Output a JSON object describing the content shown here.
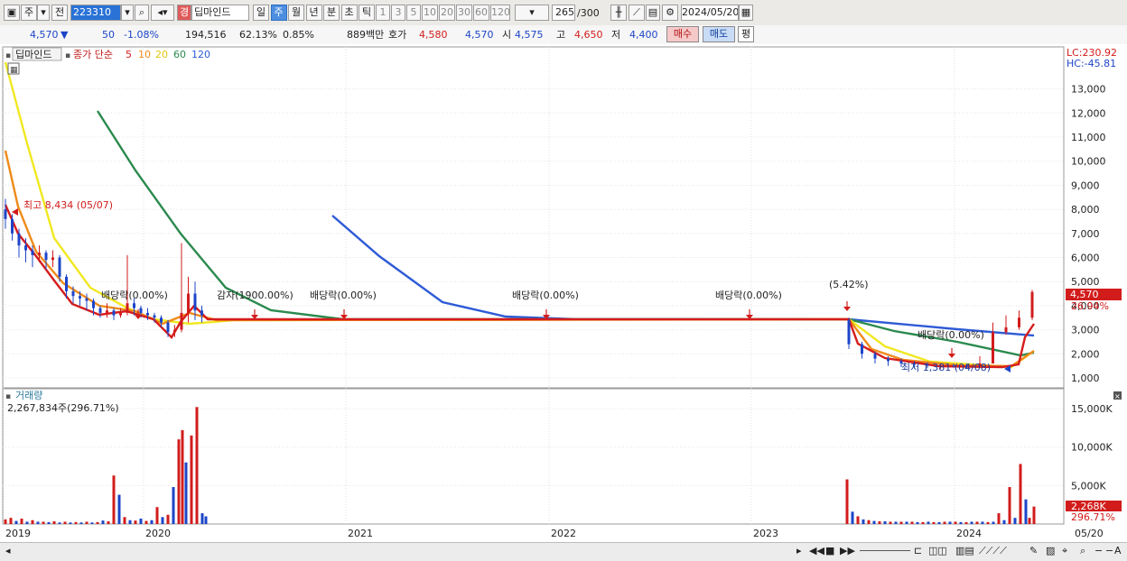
{
  "toolbar": {
    "market": "주",
    "prev": "전",
    "code": "223310",
    "name": "딥마인드",
    "name_tag": "경",
    "periods": [
      "일",
      "주",
      "월",
      "년",
      "분",
      "초",
      "틱"
    ],
    "active_period": "주",
    "intervals": [
      "1",
      "3",
      "5",
      "10",
      "20",
      "30",
      "60",
      "120"
    ],
    "count": "265",
    "total": "/300",
    "date": "2024/05/20"
  },
  "quote": {
    "price": "4,570",
    "dir_icon": "down-triangle-icon",
    "change": "50",
    "change_pct": "-1.08%",
    "volume": "194,516",
    "volume_ratio": "62.13%",
    "turnover": "0.85%",
    "amount": "889백만",
    "ask_label": "호가",
    "ask": "4,580",
    "bid": "4,570",
    "open_label": "시",
    "open": "4,575",
    "high_label": "고",
    "high": "4,650",
    "low_label": "저",
    "low": "4,400",
    "buy": "매수",
    "sell": "매도",
    "avg": "평"
  },
  "legend": {
    "name": "딥마인드",
    "title": "종가 단순",
    "ma": [
      "5",
      "10",
      "20",
      "60",
      "120"
    ],
    "ma_colors": [
      "#d61c1c",
      "#f08a1a",
      "#f0e820",
      "#2b8a4e",
      "#2e5bd6"
    ]
  },
  "price_panel": {
    "lc": "LC:230.92",
    "hc": "HC:-45.81",
    "y_ticks": [
      "13,000",
      "12,000",
      "11,000",
      "10,000",
      "9,000",
      "8,000",
      "7,000",
      "6,000",
      "5,000",
      "4,000",
      "3,000",
      "2,000",
      "1,000"
    ],
    "y_values": [
      13000,
      12000,
      11000,
      10000,
      9000,
      8000,
      7000,
      6000,
      5000,
      4000,
      3000,
      2000,
      1000
    ],
    "last_price": "4,570",
    "last_pct": "26.94%",
    "high_note": "최고 8,434 (05/07)",
    "low_note": "최저 1,381 (04/08)",
    "events": [
      {
        "label": "배당락(0.00%)",
        "pos": 0.12
      },
      {
        "label": "감자(1900.00%)",
        "pos": 0.24
      },
      {
        "label": "배당락(0.00%)",
        "pos": 0.325
      },
      {
        "label": "배당락(0.00%)",
        "pos": 0.52
      },
      {
        "label": "배당락(0.00%)",
        "pos": 0.715
      },
      {
        "label": "(5.42%)",
        "pos": 0.808
      },
      {
        "label": "배당락(0.00%)",
        "pos": 0.915
      }
    ]
  },
  "volume_panel": {
    "title": "거래량",
    "summary": "2,267,834주(296.71%)",
    "y_ticks": [
      "15,000K",
      "10,000K",
      "5,000K"
    ],
    "y_values": [
      15000,
      10000,
      5000
    ],
    "last": "2,268K",
    "last_pct": "296.71%"
  },
  "x_axis": {
    "labels": [
      "2019",
      "2020",
      "2021",
      "2022",
      "2023",
      "2024",
      "05/20"
    ]
  },
  "colors": {
    "up": "#d21c1c",
    "down": "#1c45c8",
    "accent": "#2a72d6"
  }
}
